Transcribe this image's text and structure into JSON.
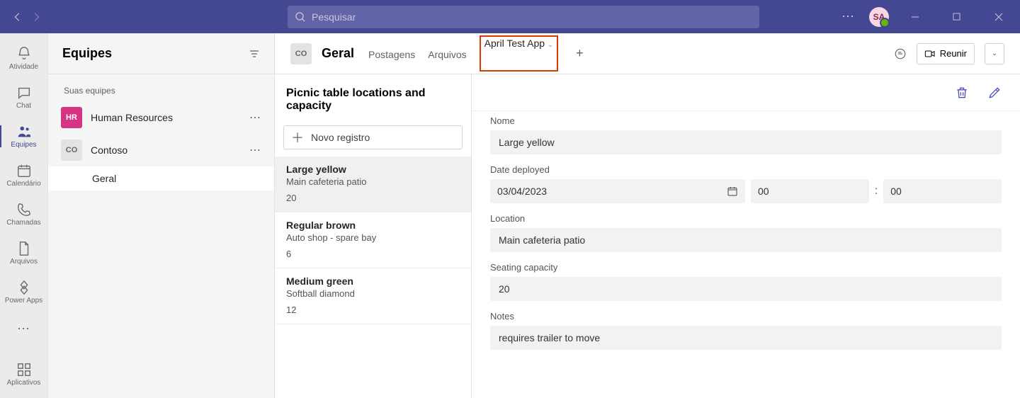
{
  "search_placeholder": "Pesquisar",
  "avatar_initials": "SA",
  "rail": [
    {
      "icon": "bell",
      "label": "Atividade"
    },
    {
      "icon": "chat",
      "label": "Chat"
    },
    {
      "icon": "teams",
      "label": "Equipes"
    },
    {
      "icon": "calendar",
      "label": "Calendário"
    },
    {
      "icon": "phone",
      "label": "Chamadas"
    },
    {
      "icon": "file",
      "label": "Arquivos"
    },
    {
      "icon": "powerapps",
      "label": "Power Apps"
    }
  ],
  "rail_apps_label": "Aplicativos",
  "teams_header": "Equipes",
  "your_teams_label": "Suas equipes",
  "teams": [
    {
      "initials": "HR",
      "name": "Human Resources",
      "avatar_class": "hr"
    },
    {
      "initials": "CO",
      "name": "Contoso",
      "avatar_class": "co"
    }
  ],
  "channel_name": "Geral",
  "content_header": {
    "avatar_initials": "CO",
    "channel_name": "Geral",
    "tabs": [
      {
        "label": "Postagens"
      },
      {
        "label": "Arquivos"
      },
      {
        "label": "April Test App",
        "highlighted": true,
        "active": true
      }
    ],
    "meet_label": "Reunir"
  },
  "chart_data": {
    "type": "table",
    "title": "Picnic table locations and capacity",
    "columns": [
      "Name",
      "Location",
      "Seating capacity"
    ],
    "rows": [
      {
        "name": "Large yellow",
        "location": "Main cafeteria patio",
        "capacity": 20
      },
      {
        "name": "Regular brown",
        "location": "Auto shop - spare bay",
        "capacity": 6
      },
      {
        "name": "Medium green",
        "location": "Softball diamond",
        "capacity": 12
      }
    ]
  },
  "list_title": "Picnic table locations and capacity",
  "new_record_label": "Novo registro",
  "records": [
    {
      "title": "Large yellow",
      "sub": "Main cafeteria patio",
      "num": "20",
      "active": true
    },
    {
      "title": "Regular brown",
      "sub": "Auto shop - spare bay",
      "num": "6"
    },
    {
      "title": "Medium green",
      "sub": "Softball diamond",
      "num": "12"
    }
  ],
  "form": {
    "name_label": "Nome",
    "name_value": "Large yellow",
    "date_label": "Date deployed",
    "date_value": "03/04/2023",
    "time_h": "00",
    "time_m": "00",
    "location_label": "Location",
    "location_value": "Main cafeteria patio",
    "capacity_label": "Seating capacity",
    "capacity_value": "20",
    "notes_label": "Notes",
    "notes_value": "requires trailer to move"
  }
}
